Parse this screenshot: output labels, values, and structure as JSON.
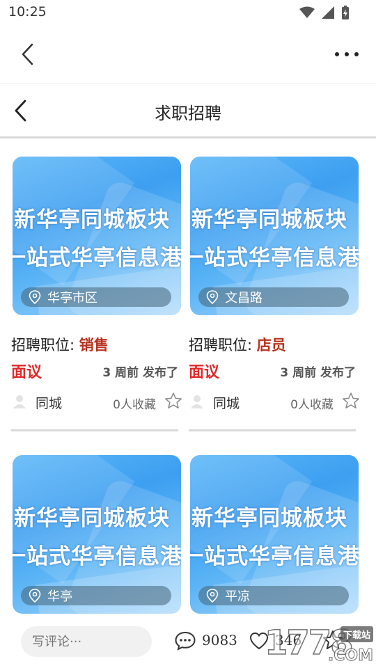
{
  "status_bar": {
    "time": "10:25"
  },
  "page": {
    "title": "求职招聘"
  },
  "banner": {
    "line1": "新华亭同城板块",
    "line2": "一站式华亭信息港"
  },
  "listings": [
    {
      "location": "华亭市区",
      "position_label": "招聘职位: ",
      "position": "销售",
      "salary": "面议",
      "posted": "3 周前 发布了",
      "city": "同城",
      "favorites": "0人收藏"
    },
    {
      "location": "文昌路",
      "position_label": "招聘职位: ",
      "position": "店员",
      "salary": "面议",
      "posted": "3 周前 发布了",
      "city": "同城",
      "favorites": "0人收藏"
    },
    {
      "location": "华亭"
    },
    {
      "location": "平凉"
    }
  ],
  "comment_bar": {
    "placeholder": "写评论···",
    "comments": "9083",
    "likes": "346"
  },
  "watermark": {
    "number": "1778",
    "badge": "下载站",
    "domain": ".COM"
  },
  "colors": {
    "position_accent": "#b8321e",
    "salary_red": "#e02a2a",
    "banner_blue": "#3d9ff1"
  }
}
